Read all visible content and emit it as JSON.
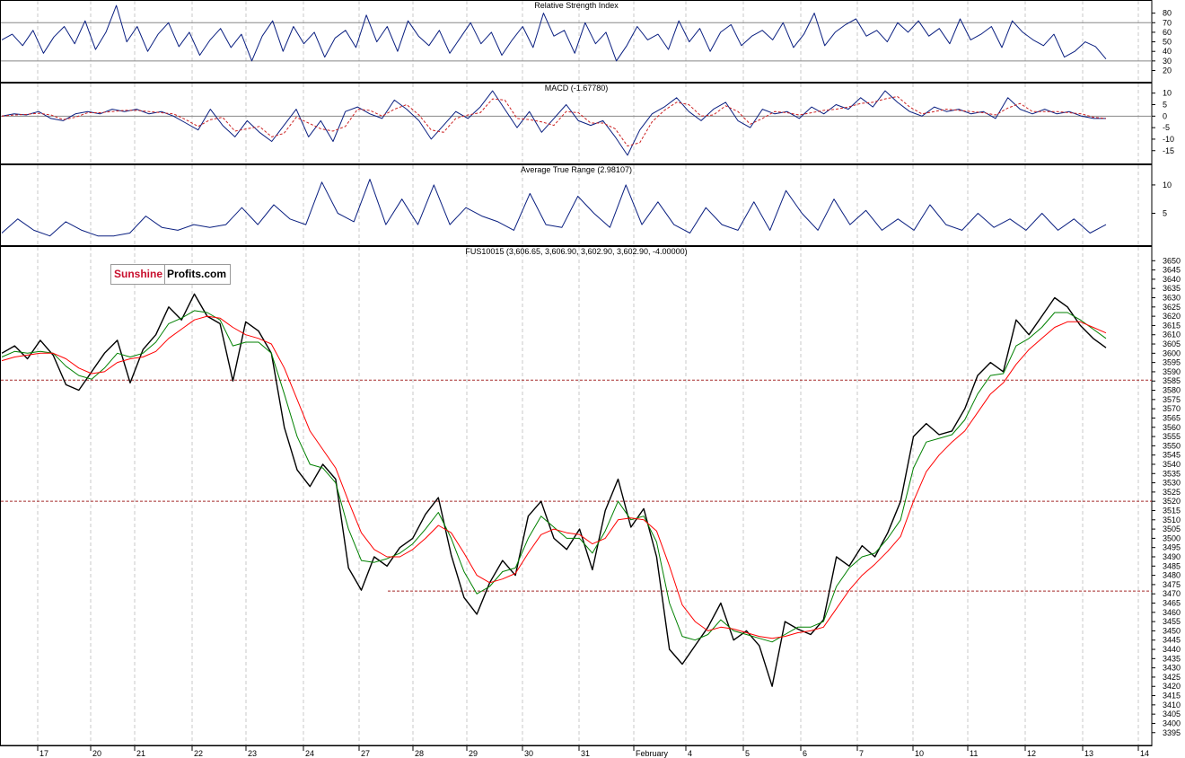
{
  "logo": {
    "part1": "Sunshine",
    "part2": "Profits.com"
  },
  "chart_data": [
    {
      "type": "line",
      "title": "Relative Strength Index",
      "ylim": [
        12,
        90
      ],
      "yticks": [
        80,
        70,
        60,
        50,
        40,
        30,
        20
      ],
      "reference_lines": [
        70,
        30
      ],
      "series": [
        {
          "values": [
            52,
            58,
            46,
            62,
            38,
            55,
            66,
            48,
            72,
            42,
            60,
            88,
            50,
            66,
            40,
            58,
            70,
            45,
            60,
            36,
            52,
            64,
            44,
            58,
            30,
            56,
            72,
            40,
            66,
            48,
            60,
            34,
            54,
            62,
            44,
            78,
            50,
            66,
            40,
            72,
            56,
            46,
            62,
            38,
            54,
            70,
            48,
            60,
            36,
            52,
            66,
            44,
            80,
            56,
            62,
            38,
            70,
            48,
            60,
            30,
            46,
            66,
            52,
            58,
            42,
            72,
            50,
            64,
            40,
            60,
            68,
            46,
            56,
            62,
            52,
            70,
            44,
            58,
            80,
            46,
            60,
            68,
            74,
            56,
            62,
            50,
            70,
            60,
            72,
            56,
            64,
            48,
            74,
            52,
            58,
            66,
            44,
            72,
            60,
            52,
            46,
            58,
            34,
            40,
            50,
            45,
            32
          ]
        }
      ]
    },
    {
      "type": "line",
      "title": "MACD (-1.67780)",
      "ylim": [
        -19,
        13
      ],
      "yticks": [
        10,
        5,
        0,
        -5,
        -10,
        -15
      ],
      "reference_lines": [
        0
      ],
      "series": [
        {
          "values": [
            0,
            1,
            0.5,
            2,
            -1,
            -2,
            1,
            2,
            1,
            3,
            2,
            3,
            1,
            2,
            0,
            -3,
            -6,
            3,
            -4,
            -9,
            -2,
            -7,
            -11,
            -4,
            3,
            -9,
            -2,
            -11,
            2,
            4,
            1,
            -1,
            7,
            3,
            -2,
            -10,
            -4,
            2,
            -1,
            4,
            11,
            3,
            -5,
            2,
            -7,
            -1,
            5,
            -2,
            -4,
            -2,
            -9,
            -17,
            -6,
            1,
            4,
            8,
            2,
            -2,
            3,
            6,
            -2,
            -5,
            3,
            1,
            2,
            -1,
            4,
            1,
            5,
            3,
            8,
            4,
            11,
            6,
            2,
            0,
            4,
            2,
            3,
            1,
            2,
            -1,
            8,
            3,
            1,
            3,
            1,
            2,
            0,
            -1,
            -1
          ]
        }
      ]
    },
    {
      "type": "line",
      "title": "Average True Range (2.98107)",
      "ylim": [
        0,
        13
      ],
      "yticks": [
        10,
        5
      ],
      "series": [
        {
          "values": [
            1.5,
            4,
            2,
            1,
            3.5,
            2,
            1,
            1,
            1.5,
            4.5,
            2.5,
            2,
            3,
            2.5,
            3,
            6,
            3,
            6.5,
            4,
            3,
            10.5,
            5,
            3.5,
            11,
            3,
            7.5,
            3,
            10,
            3,
            6,
            4.5,
            3.5,
            2,
            8.5,
            3,
            2.5,
            8,
            5,
            2.5,
            10,
            3,
            7,
            3,
            1.5,
            6,
            3,
            2,
            7,
            2,
            9,
            5,
            2,
            7.5,
            3,
            5.5,
            2,
            4,
            2,
            6.5,
            3,
            2,
            5,
            2.5,
            4,
            2,
            5,
            2,
            4,
            1.5,
            3
          ]
        }
      ]
    },
    {
      "type": "line",
      "title": "FUS10015 (3,606.65, 3,606.90, 3,602.90, 3,602.90, -4.00000)",
      "ylim": [
        3391,
        3655
      ],
      "yticks": [
        3650,
        3645,
        3640,
        3635,
        3630,
        3625,
        3620,
        3615,
        3610,
        3605,
        3600,
        3595,
        3590,
        3585,
        3580,
        3575,
        3570,
        3565,
        3560,
        3555,
        3550,
        3545,
        3540,
        3535,
        3530,
        3525,
        3520,
        3515,
        3510,
        3505,
        3500,
        3495,
        3490,
        3485,
        3480,
        3475,
        3470,
        3465,
        3460,
        3455,
        3450,
        3445,
        3440,
        3435,
        3430,
        3425,
        3420,
        3415,
        3410,
        3405,
        3400,
        3395
      ],
      "x_tick_labels": [
        "17",
        "20",
        "21",
        "22",
        "23",
        "24",
        "27",
        "28",
        "29",
        "30",
        "31",
        "February",
        "4",
        "5",
        "6",
        "7",
        "10",
        "11",
        "12",
        "13",
        "14"
      ],
      "horizontal_levels": [
        3585.5,
        3520,
        3471.5
      ],
      "series": [
        {
          "name": "Price",
          "color": "#000000",
          "values": [
            3600,
            3604,
            3597,
            3607,
            3599,
            3583,
            3580,
            3590,
            3600,
            3607,
            3584,
            3602,
            3610,
            3625,
            3618,
            3632,
            3620,
            3616,
            3585,
            3617,
            3612,
            3600,
            3560,
            3537,
            3528,
            3540,
            3532,
            3484,
            3472,
            3490,
            3485,
            3495,
            3500,
            3513,
            3522,
            3491,
            3468,
            3459,
            3476,
            3488,
            3480,
            3512,
            3520,
            3500,
            3494,
            3505,
            3483,
            3515,
            3532,
            3506,
            3516,
            3490,
            3440,
            3432,
            3442,
            3452,
            3465,
            3445,
            3450,
            3442,
            3420,
            3455,
            3451,
            3448,
            3456,
            3490,
            3485,
            3496,
            3490,
            3503,
            3520,
            3555,
            3562,
            3556,
            3558,
            3570,
            3588,
            3595,
            3590,
            3618,
            3610,
            3620,
            3630,
            3625,
            3615,
            3608,
            3603
          ]
        },
        {
          "name": "MA short",
          "color": "#008000",
          "values": [
            3598,
            3601,
            3600,
            3601,
            3600,
            3593,
            3588,
            3586,
            3592,
            3600,
            3598,
            3600,
            3606,
            3616,
            3619,
            3623,
            3622,
            3618,
            3604,
            3606,
            3606,
            3600,
            3578,
            3555,
            3540,
            3538,
            3530,
            3505,
            3488,
            3487,
            3489,
            3492,
            3497,
            3505,
            3514,
            3500,
            3482,
            3470,
            3474,
            3482,
            3484,
            3500,
            3512,
            3506,
            3500,
            3500,
            3492,
            3504,
            3520,
            3510,
            3512,
            3498,
            3465,
            3447,
            3445,
            3448,
            3456,
            3450,
            3448,
            3446,
            3444,
            3448,
            3452,
            3452,
            3455,
            3474,
            3484,
            3490,
            3492,
            3500,
            3510,
            3538,
            3552,
            3554,
            3556,
            3564,
            3578,
            3588,
            3589,
            3604,
            3608,
            3614,
            3622,
            3622,
            3618,
            3613,
            3608
          ]
        },
        {
          "name": "MA long",
          "color": "#ff0000",
          "values": [
            3596,
            3598,
            3599,
            3600,
            3600,
            3597,
            3592,
            3589,
            3590,
            3595,
            3597,
            3598,
            3601,
            3608,
            3613,
            3618,
            3620,
            3619,
            3614,
            3610,
            3608,
            3605,
            3592,
            3575,
            3558,
            3548,
            3538,
            3520,
            3503,
            3494,
            3490,
            3490,
            3494,
            3500,
            3507,
            3503,
            3492,
            3480,
            3476,
            3478,
            3481,
            3492,
            3502,
            3505,
            3503,
            3502,
            3497,
            3500,
            3510,
            3511,
            3510,
            3504,
            3485,
            3464,
            3455,
            3450,
            3452,
            3451,
            3449,
            3447,
            3446,
            3447,
            3449,
            3450,
            3452,
            3462,
            3472,
            3480,
            3486,
            3493,
            3501,
            3520,
            3536,
            3545,
            3552,
            3558,
            3568,
            3578,
            3584,
            3594,
            3602,
            3608,
            3614,
            3617,
            3617,
            3614,
            3611
          ]
        }
      ]
    }
  ]
}
